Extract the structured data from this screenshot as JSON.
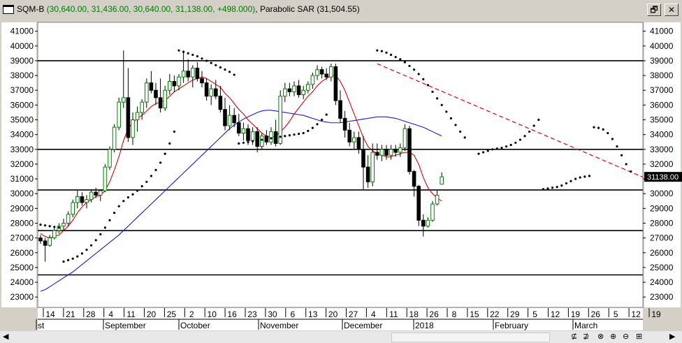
{
  "window": {
    "symbol": "SQM-B",
    "ohlc_text": "(30,640.00, 31,436.00, 30,640.00, 31,138.00, +498.000)",
    "indicator_text": "Parabolic SAR (31,504.55)",
    "restore_glyph": "🗗",
    "close_glyph": "✕"
  },
  "colors": {
    "candle_up": "#008000",
    "candle_down": "#000000",
    "wick": "#000000",
    "sar": "#000000",
    "fast_ma": "#e00000",
    "slow_ma": "#1a1acc",
    "trendline": "#e00000",
    "hline": "#000000",
    "plot_bg": "#ffffff",
    "last_price_bg": "#000000",
    "last_price_fg": "#ffffff"
  },
  "chart_data": {
    "type": "candlestick",
    "ylim": [
      22300,
      41600
    ],
    "y_ticks": [
      23000,
      24000,
      25000,
      26000,
      27000,
      28000,
      29000,
      30000,
      31000,
      32000,
      33000,
      34000,
      35000,
      36000,
      37000,
      38000,
      39000,
      40000,
      41000
    ],
    "last_price_label": "31138.00",
    "last_price": 31138,
    "x_ticks": [
      "14",
      "21",
      "28",
      "4",
      "11",
      "20",
      "25",
      "2",
      "10",
      "16",
      "23",
      "30",
      "6",
      "13",
      "20",
      "27",
      "4",
      "11",
      "18",
      "26",
      "8",
      "15",
      "22",
      "29",
      "5",
      "12",
      "19",
      "26",
      "5",
      "12",
      "19"
    ],
    "months": [
      "st",
      "September",
      "October",
      "November",
      "December",
      "2018",
      "February",
      "March"
    ],
    "candles": [
      [
        27000,
        27200,
        26600,
        26800
      ],
      [
        26800,
        27000,
        25400,
        26500
      ],
      [
        26500,
        27200,
        26400,
        27000
      ],
      [
        27000,
        27800,
        26900,
        27500
      ],
      [
        27500,
        28000,
        27300,
        27800
      ],
      [
        27800,
        28300,
        27500,
        28000
      ],
      [
        28000,
        28800,
        27800,
        28600
      ],
      [
        28600,
        29600,
        28400,
        29400
      ],
      [
        29400,
        30200,
        29000,
        29800
      ],
      [
        29800,
        30100,
        29200,
        29400
      ],
      [
        29400,
        29900,
        29000,
        29600
      ],
      [
        29600,
        30300,
        29400,
        30100
      ],
      [
        30100,
        30400,
        29700,
        29900
      ],
      [
        29900,
        30300,
        29500,
        30200
      ],
      [
        30200,
        32000,
        30100,
        31800
      ],
      [
        31800,
        33200,
        31600,
        33000
      ],
      [
        33000,
        34700,
        32800,
        34500
      ],
      [
        34500,
        36500,
        34300,
        36200
      ],
      [
        36200,
        39700,
        35800,
        36500
      ],
      [
        36500,
        38500,
        33500,
        33800
      ],
      [
        33800,
        35500,
        33300,
        35000
      ],
      [
        35000,
        35900,
        34200,
        35500
      ],
      [
        35500,
        36400,
        35000,
        36200
      ],
      [
        36200,
        37800,
        35800,
        37500
      ],
      [
        37500,
        38300,
        36800,
        37000
      ],
      [
        37000,
        37500,
        36000,
        36500
      ],
      [
        36500,
        37800,
        35500,
        35800
      ],
      [
        35800,
        37300,
        35600,
        37000
      ],
      [
        37000,
        38100,
        36700,
        37600
      ],
      [
        37600,
        38000,
        36900,
        37300
      ],
      [
        37300,
        38100,
        37000,
        37900
      ],
      [
        37900,
        39700,
        37500,
        38300
      ],
      [
        38300,
        39100,
        37600,
        37900
      ],
      [
        37900,
        38700,
        37200,
        38500
      ],
      [
        38500,
        38900,
        37600,
        37800
      ],
      [
        37800,
        38300,
        37200,
        37500
      ],
      [
        37500,
        37800,
        36300,
        36600
      ],
      [
        36600,
        37400,
        36000,
        37100
      ],
      [
        37100,
        37700,
        36400,
        36600
      ],
      [
        36600,
        37300,
        35500,
        35700
      ],
      [
        35700,
        36500,
        34300,
        34600
      ],
      [
        34600,
        36000,
        34300,
        35300
      ],
      [
        35300,
        35800,
        34500,
        34800
      ],
      [
        34800,
        35400,
        33900,
        34100
      ],
      [
        34100,
        34800,
        33600,
        34400
      ],
      [
        34400,
        34700,
        33300,
        33600
      ],
      [
        33600,
        34500,
        33300,
        34200
      ],
      [
        34200,
        34500,
        32800,
        33200
      ],
      [
        33200,
        34100,
        33000,
        33900
      ],
      [
        33900,
        34300,
        33300,
        33500
      ],
      [
        33500,
        34500,
        33300,
        34200
      ],
      [
        34200,
        35000,
        33200,
        33400
      ],
      [
        33400,
        37000,
        33300,
        36600
      ],
      [
        36600,
        37500,
        36200,
        37100
      ],
      [
        37100,
        37500,
        36600,
        36900
      ],
      [
        36900,
        37600,
        36600,
        37300
      ],
      [
        37300,
        37700,
        36500,
        36700
      ],
      [
        36700,
        37300,
        36400,
        37000
      ],
      [
        37000,
        37600,
        36800,
        37400
      ],
      [
        37400,
        38200,
        37100,
        38000
      ],
      [
        38000,
        38700,
        37700,
        38400
      ],
      [
        38400,
        38600,
        37800,
        38100
      ],
      [
        38100,
        38500,
        37700,
        37900
      ],
      [
        37900,
        38800,
        37600,
        38600
      ],
      [
        38600,
        38800,
        36000,
        36300
      ],
      [
        36300,
        37000,
        34800,
        35100
      ],
      [
        35100,
        35600,
        33800,
        34300
      ],
      [
        34300,
        34800,
        33200,
        33500
      ],
      [
        33500,
        34200,
        33000,
        33800
      ],
      [
        33800,
        34200,
        32700,
        33000
      ],
      [
        33000,
        33900,
        30300,
        31800
      ],
      [
        31800,
        32600,
        30400,
        30800
      ],
      [
        30800,
        33400,
        30500,
        32800
      ],
      [
        32800,
        33400,
        32300,
        32600
      ],
      [
        32600,
        33300,
        32200,
        33000
      ],
      [
        33000,
        33300,
        32300,
        32600
      ],
      [
        32600,
        33300,
        32300,
        33000
      ],
      [
        33000,
        33300,
        32500,
        32800
      ],
      [
        32800,
        33400,
        32500,
        33100
      ],
      [
        33100,
        34700,
        32900,
        34400
      ],
      [
        34400,
        34600,
        31300,
        31500
      ],
      [
        31500,
        31600,
        29800,
        30500
      ],
      [
        30500,
        30600,
        27800,
        28200
      ],
      [
        28200,
        28600,
        27100,
        27800
      ],
      [
        27800,
        28400,
        27700,
        28200
      ],
      [
        28200,
        29500,
        28100,
        29300
      ],
      [
        29300,
        30200,
        29200,
        29900
      ],
      [
        30640,
        31436,
        30640,
        31138
      ]
    ],
    "fast_ma": [
      27300,
      27100,
      27000,
      27100,
      27200,
      27500,
      27800,
      28200,
      28700,
      29100,
      29400,
      29600,
      29800,
      29900,
      30200,
      30800,
      31600,
      32500,
      33600,
      34400,
      34800,
      35100,
      35300,
      35600,
      35900,
      36100,
      36200,
      36300,
      36600,
      36900,
      37100,
      37300,
      37500,
      37700,
      37800,
      37900,
      37800,
      37600,
      37400,
      37200,
      36800,
      36500,
      36100,
      35700,
      35400,
      35000,
      34700,
      34400,
      34100,
      33900,
      33800,
      33900,
      34200,
      34500,
      34900,
      35400,
      35800,
      36200,
      36600,
      36900,
      37300,
      37600,
      37800,
      38000,
      38000,
      37600,
      37000,
      36200,
      35400,
      34600,
      33800,
      33200,
      32900,
      32700,
      32600,
      32500,
      32500,
      32600,
      32700,
      32800,
      32800,
      32600,
      32000,
      31100,
      30400,
      30000,
      29700,
      29500
    ],
    "slow_ma": [
      23400,
      23500,
      23700,
      23900,
      24100,
      24300,
      24500,
      24700,
      24950,
      25200,
      25450,
      25700,
      25950,
      26200,
      26450,
      26700,
      26950,
      27200,
      27500,
      27800,
      28100,
      28400,
      28700,
      29000,
      29300,
      29600,
      29900,
      30200,
      30500,
      30800,
      31100,
      31400,
      31700,
      32000,
      32300,
      32600,
      32900,
      33200,
      33500,
      33800,
      34100,
      34400,
      34650,
      34850,
      35050,
      35200,
      35350,
      35500,
      35600,
      35650,
      35650,
      35600,
      35550,
      35500,
      35450,
      35400,
      35350,
      35300,
      35200,
      35100,
      35000,
      34900,
      34850,
      34800,
      34800,
      34800,
      34850,
      34900,
      34950,
      35000,
      35050,
      35100,
      35150,
      35200,
      35200,
      35200,
      35150,
      35100,
      35000,
      34900,
      34800,
      34700,
      34600,
      34500,
      34350,
      34200,
      34050,
      33900
    ],
    "sar": [
      [
        0,
        27900
      ],
      [
        1,
        27850
      ],
      [
        2,
        27800
      ],
      [
        3,
        27750
      ],
      [
        4,
        27700
      ],
      [
        5,
        25400
      ],
      [
        6,
        25500
      ],
      [
        7,
        25600
      ],
      [
        8,
        25750
      ],
      [
        9,
        25950
      ],
      [
        10,
        26200
      ],
      [
        11,
        26500
      ],
      [
        12,
        26850
      ],
      [
        13,
        27250
      ],
      [
        14,
        27700
      ],
      [
        15,
        28200
      ],
      [
        16,
        28700
      ],
      [
        17,
        29150
      ],
      [
        18,
        29500
      ],
      [
        19,
        29750
      ],
      [
        20,
        29950
      ],
      [
        21,
        30200
      ],
      [
        22,
        30500
      ],
      [
        23,
        30800
      ],
      [
        24,
        31200
      ],
      [
        25,
        31600
      ],
      [
        26,
        32100
      ],
      [
        27,
        32700
      ],
      [
        28,
        33400
      ],
      [
        29,
        34200
      ],
      [
        30,
        39700
      ],
      [
        31,
        39600
      ],
      [
        32,
        39500
      ],
      [
        33,
        39400
      ],
      [
        34,
        39300
      ],
      [
        35,
        39150
      ],
      [
        36,
        39000
      ],
      [
        37,
        38850
      ],
      [
        38,
        38700
      ],
      [
        39,
        38550
      ],
      [
        40,
        38400
      ],
      [
        41,
        38250
      ],
      [
        42,
        38050
      ],
      [
        43,
        33400
      ],
      [
        44,
        33450
      ],
      [
        45,
        33500
      ],
      [
        46,
        33550
      ],
      [
        47,
        33600
      ],
      [
        48,
        33650
      ],
      [
        49,
        33700
      ],
      [
        50,
        33750
      ],
      [
        51,
        33800
      ],
      [
        52,
        33850
      ],
      [
        53,
        33900
      ],
      [
        54,
        33950
      ],
      [
        55,
        34000
      ],
      [
        56,
        34050
      ],
      [
        57,
        34100
      ],
      [
        58,
        34250
      ],
      [
        59,
        34450
      ],
      [
        60,
        34700
      ],
      [
        61,
        35000
      ],
      [
        62,
        35350
      ],
      [
        73,
        39700
      ],
      [
        74,
        39650
      ],
      [
        75,
        39550
      ],
      [
        76,
        39400
      ],
      [
        77,
        39250
      ],
      [
        78,
        39100
      ],
      [
        79,
        38900
      ],
      [
        80,
        38650
      ],
      [
        81,
        38400
      ],
      [
        82,
        38100
      ],
      [
        83,
        37750
      ],
      [
        84,
        37350
      ],
      [
        85,
        36900
      ],
      [
        86,
        36450
      ],
      [
        87,
        36000
      ],
      [
        88,
        35550
      ],
      [
        89,
        35100
      ],
      [
        90,
        34650
      ],
      [
        91,
        34200
      ],
      [
        92,
        33800
      ],
      [
        95,
        32700
      ],
      [
        96,
        32800
      ],
      [
        97,
        32900
      ],
      [
        98,
        33000
      ],
      [
        99,
        33050
      ],
      [
        100,
        33100
      ],
      [
        101,
        33200
      ],
      [
        102,
        33300
      ],
      [
        103,
        33450
      ],
      [
        104,
        33650
      ],
      [
        105,
        33900
      ],
      [
        106,
        34200
      ],
      [
        107,
        34600
      ],
      [
        108,
        35000
      ],
      [
        109,
        30300
      ],
      [
        110,
        30350
      ],
      [
        111,
        30400
      ],
      [
        112,
        30450
      ],
      [
        113,
        30550
      ],
      [
        114,
        30700
      ],
      [
        115,
        30850
      ],
      [
        116,
        31000
      ],
      [
        117,
        31100
      ],
      [
        118,
        31150
      ],
      [
        119,
        31200
      ],
      [
        120,
        34500
      ],
      [
        121,
        34450
      ],
      [
        122,
        34350
      ],
      [
        123,
        34100
      ],
      [
        124,
        33700
      ],
      [
        125,
        33200
      ],
      [
        126,
        32600
      ],
      [
        127,
        32000
      ],
      [
        128,
        31500
      ]
    ],
    "hlines": [
      39000,
      33000,
      30250,
      27500,
      24500
    ],
    "trendline": [
      [
        73,
        38800
      ],
      [
        127,
        31600
      ]
    ],
    "grid": false,
    "legend": "none"
  },
  "nav": {
    "left_arrow": "◀",
    "right_arrow": "▶",
    "buttons": [
      "⊈",
      "⊉",
      "⊗",
      "⊕",
      "⊖",
      "⊞"
    ]
  }
}
